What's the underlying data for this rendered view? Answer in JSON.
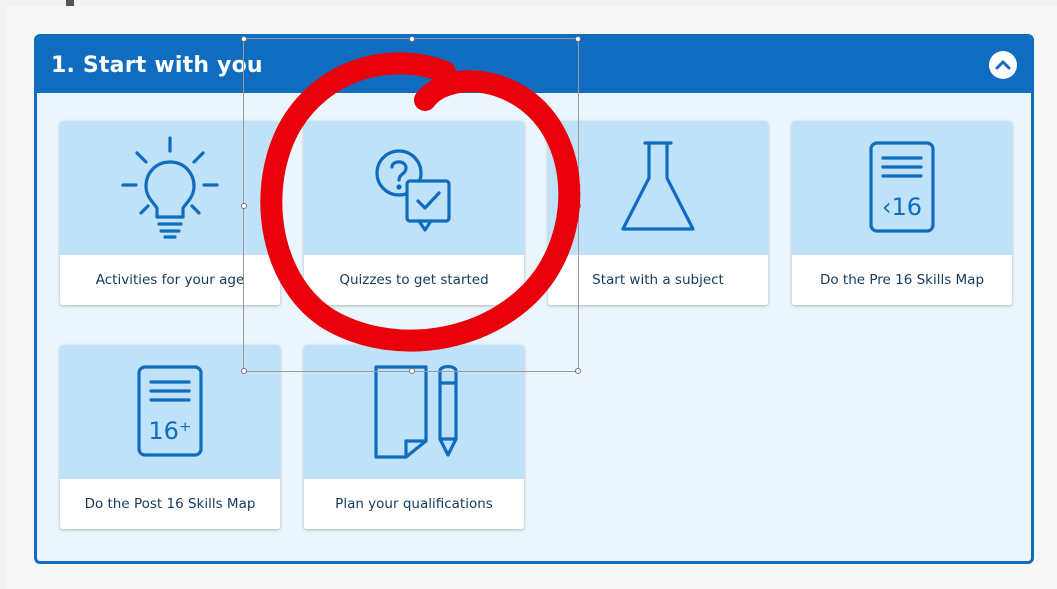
{
  "panel": {
    "title": "1. Start with you",
    "accent_color": "#0f6cbf",
    "tile_color": "#bfe2f8",
    "collapse_icon": "chevron-up-icon"
  },
  "cards": [
    {
      "label": "Activities for your age",
      "icon": "lightbulb-icon"
    },
    {
      "label": "Quizzes to get started",
      "icon": "quiz-icon"
    },
    {
      "label": "Start with a subject",
      "icon": "flask-icon"
    },
    {
      "label": "Do the Pre 16 Skills Map",
      "icon": "pre16-document-icon",
      "icon_text": "‹16"
    },
    {
      "label": "Do the Post 16 Skills Map",
      "icon": "post16-document-icon",
      "icon_text": "16⁺"
    },
    {
      "label": "Plan your qualifications",
      "icon": "paper-pencil-icon"
    }
  ],
  "annotation": {
    "type": "red-circle",
    "color": "#e8000b"
  }
}
